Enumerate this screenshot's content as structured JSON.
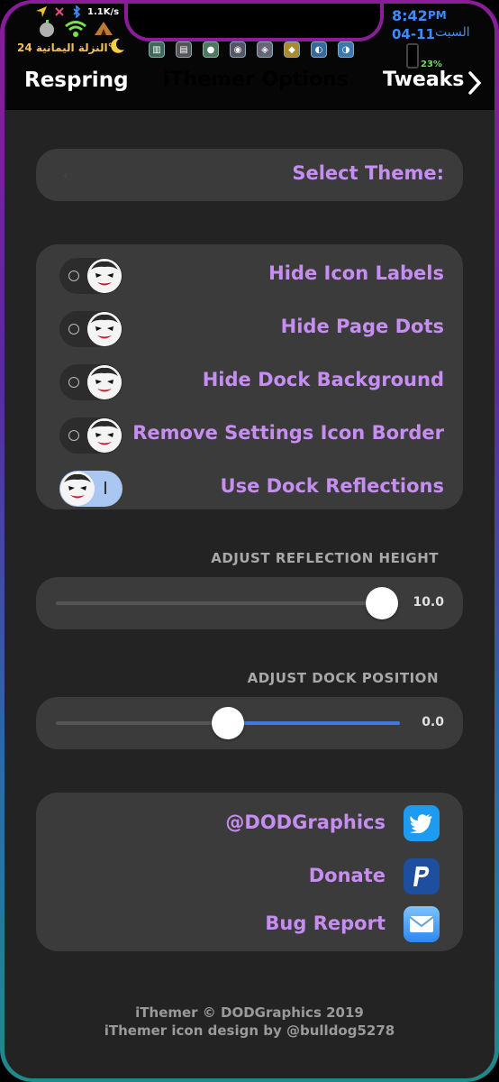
{
  "status_bar": {
    "net_speed": "1.1K/s",
    "time": "8:42",
    "ampm": "PM",
    "date": "04-11",
    "weekday": "السبت",
    "battery_percent": "23%",
    "arabic_label": "النزلة اليمانية 24°",
    "icons": [
      "location-icon",
      "mute-icon",
      "bluetooth-icon",
      "apple-icon",
      "wifi-icon",
      "tent-icon",
      "moon-icon"
    ]
  },
  "navbar": {
    "left_label": "Respring",
    "title": "iThemer Options",
    "right_label": "Tweaks"
  },
  "theme_select": {
    "label": "Select Theme:"
  },
  "toggles": [
    {
      "label": "Hide Icon Labels",
      "on": false
    },
    {
      "label": "Hide Page Dots",
      "on": false
    },
    {
      "label": "Hide Dock Background",
      "on": false
    },
    {
      "label": "Remove Settings Icon Border",
      "on": false
    },
    {
      "label": "Use Dock Reflections",
      "on": true
    }
  ],
  "reflection_height": {
    "header": "ADJUST REFLECTION HEIGHT",
    "value": "10.0",
    "fraction": 1.0
  },
  "dock_position": {
    "header": "ADJUST DOCK POSITION",
    "value": "0.0",
    "fraction": 0.5
  },
  "links": [
    {
      "label": "@DODGraphics",
      "icon": "twitter-icon",
      "color": "#1d9bf0"
    },
    {
      "label": "Donate",
      "icon": "paypal-icon",
      "color": "#1d4f9e"
    },
    {
      "label": "Bug Report",
      "icon": "mail-icon",
      "color": "#4aa3f5"
    }
  ],
  "footer": {
    "line1": "iThemer © DODGraphics 2019",
    "line2": "iThemer icon design by @bulldog5278"
  },
  "colors": {
    "accent_text": "#c58ef0",
    "background": "#232323",
    "card": "#3b3b3b",
    "slider_fill": "#3e7be0",
    "frame_top": "#8b1c9a",
    "frame_bottom": "#1f8a8a"
  }
}
